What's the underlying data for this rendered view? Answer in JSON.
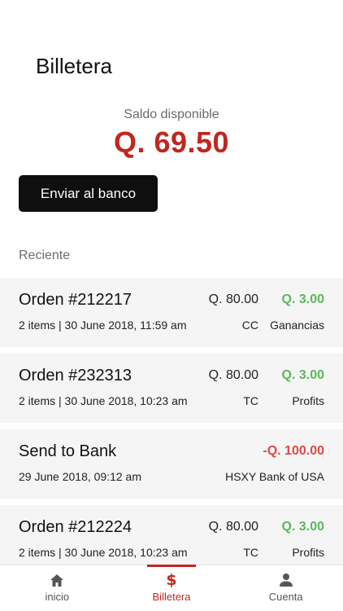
{
  "header": {
    "title": "Billetera"
  },
  "balance": {
    "label": "Saldo disponible",
    "value": "Q. 69.50"
  },
  "actions": {
    "send_label": "Enviar al banco"
  },
  "recent": {
    "label": "Reciente",
    "items": [
      {
        "title": "Orden #212217",
        "subtitle": "2 items | 30 June 2018, 11:59 am",
        "amount": "Q. 80.00",
        "fee": "Q. 3.00",
        "method": "CC",
        "note": "Ganancias"
      },
      {
        "title": "Orden #232313",
        "subtitle": "2 items | 30 June 2018, 10:23 am",
        "amount": "Q. 80.00",
        "fee": "Q. 3.00",
        "method": "TC",
        "note": "Profits"
      },
      {
        "title": "Send to Bank",
        "subtitle": "29 June 2018, 09:12 am",
        "amount": "",
        "fee": "-Q. 100.00",
        "method": "",
        "note": "HSXY Bank of USA"
      },
      {
        "title": "Orden #212224",
        "subtitle": "2 items | 30 June 2018, 10:23 am",
        "amount": "Q. 80.00",
        "fee": "Q. 3.00",
        "method": "TC",
        "note": "Profits"
      }
    ]
  },
  "tabbar": {
    "items": [
      {
        "label": "inicio",
        "icon": "home-icon"
      },
      {
        "label": "Billetera",
        "icon": "dollar-icon"
      },
      {
        "label": "Cuenta",
        "icon": "user-icon"
      }
    ]
  },
  "colors": {
    "accent": "#c0271f",
    "positive": "#5cb85c",
    "negative": "#e04848"
  }
}
